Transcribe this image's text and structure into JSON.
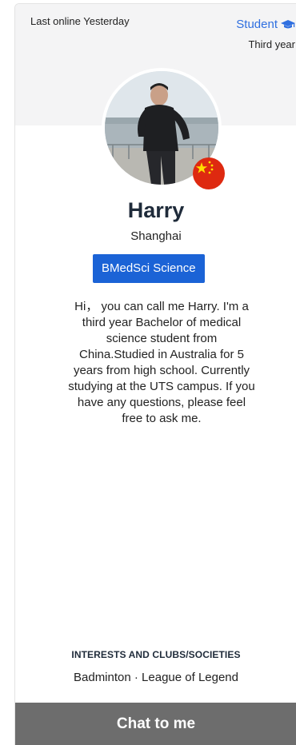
{
  "status": {
    "last_online": "Last online Yesterday"
  },
  "profile": {
    "role": "Student",
    "year": "Third year",
    "name": "Harry",
    "city": "Shanghai",
    "course": "BMedSci Science",
    "bio": "Hi， you can call me Harry. I'm a\nthird year Bachelor of medical\nscience student from\nChina.Studied in Australia for 5\nyears from high school. Currently\nstudying at the UTS campus. If you\nhave any questions, please feel\nfree to ask me."
  },
  "interests": {
    "title": "INTERESTS AND CLUBS/SOCIETIES",
    "text": "Badminton · League of Legend"
  },
  "actions": {
    "chat_label": "Chat to me"
  },
  "colors": {
    "accent": "#1b63d6",
    "role_text": "#2f6fe0",
    "button_bg": "#6d6d6d",
    "flag_red": "#de2910",
    "flag_yellow": "#ffde00"
  }
}
